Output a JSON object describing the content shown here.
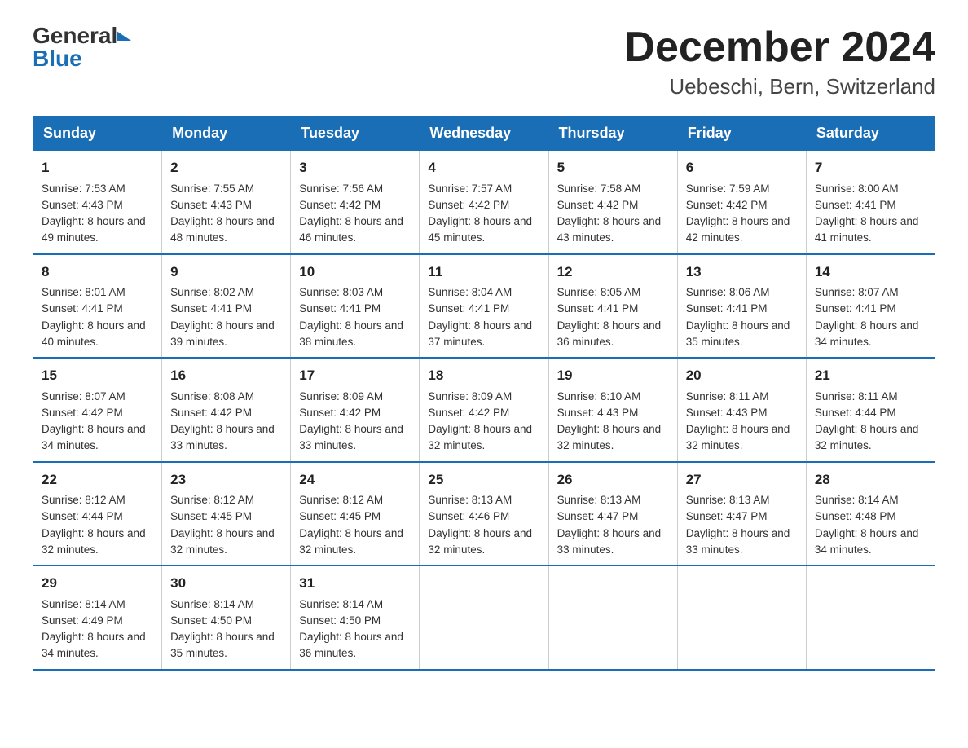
{
  "logo": {
    "general": "General",
    "blue": "Blue"
  },
  "title": "December 2024",
  "subtitle": "Uebeschi, Bern, Switzerland",
  "days_of_week": [
    "Sunday",
    "Monday",
    "Tuesday",
    "Wednesday",
    "Thursday",
    "Friday",
    "Saturday"
  ],
  "weeks": [
    [
      {
        "day": "1",
        "sunrise": "7:53 AM",
        "sunset": "4:43 PM",
        "daylight": "8 hours and 49 minutes."
      },
      {
        "day": "2",
        "sunrise": "7:55 AM",
        "sunset": "4:43 PM",
        "daylight": "8 hours and 48 minutes."
      },
      {
        "day": "3",
        "sunrise": "7:56 AM",
        "sunset": "4:42 PM",
        "daylight": "8 hours and 46 minutes."
      },
      {
        "day": "4",
        "sunrise": "7:57 AM",
        "sunset": "4:42 PM",
        "daylight": "8 hours and 45 minutes."
      },
      {
        "day": "5",
        "sunrise": "7:58 AM",
        "sunset": "4:42 PM",
        "daylight": "8 hours and 43 minutes."
      },
      {
        "day": "6",
        "sunrise": "7:59 AM",
        "sunset": "4:42 PM",
        "daylight": "8 hours and 42 minutes."
      },
      {
        "day": "7",
        "sunrise": "8:00 AM",
        "sunset": "4:41 PM",
        "daylight": "8 hours and 41 minutes."
      }
    ],
    [
      {
        "day": "8",
        "sunrise": "8:01 AM",
        "sunset": "4:41 PM",
        "daylight": "8 hours and 40 minutes."
      },
      {
        "day": "9",
        "sunrise": "8:02 AM",
        "sunset": "4:41 PM",
        "daylight": "8 hours and 39 minutes."
      },
      {
        "day": "10",
        "sunrise": "8:03 AM",
        "sunset": "4:41 PM",
        "daylight": "8 hours and 38 minutes."
      },
      {
        "day": "11",
        "sunrise": "8:04 AM",
        "sunset": "4:41 PM",
        "daylight": "8 hours and 37 minutes."
      },
      {
        "day": "12",
        "sunrise": "8:05 AM",
        "sunset": "4:41 PM",
        "daylight": "8 hours and 36 minutes."
      },
      {
        "day": "13",
        "sunrise": "8:06 AM",
        "sunset": "4:41 PM",
        "daylight": "8 hours and 35 minutes."
      },
      {
        "day": "14",
        "sunrise": "8:07 AM",
        "sunset": "4:41 PM",
        "daylight": "8 hours and 34 minutes."
      }
    ],
    [
      {
        "day": "15",
        "sunrise": "8:07 AM",
        "sunset": "4:42 PM",
        "daylight": "8 hours and 34 minutes."
      },
      {
        "day": "16",
        "sunrise": "8:08 AM",
        "sunset": "4:42 PM",
        "daylight": "8 hours and 33 minutes."
      },
      {
        "day": "17",
        "sunrise": "8:09 AM",
        "sunset": "4:42 PM",
        "daylight": "8 hours and 33 minutes."
      },
      {
        "day": "18",
        "sunrise": "8:09 AM",
        "sunset": "4:42 PM",
        "daylight": "8 hours and 32 minutes."
      },
      {
        "day": "19",
        "sunrise": "8:10 AM",
        "sunset": "4:43 PM",
        "daylight": "8 hours and 32 minutes."
      },
      {
        "day": "20",
        "sunrise": "8:11 AM",
        "sunset": "4:43 PM",
        "daylight": "8 hours and 32 minutes."
      },
      {
        "day": "21",
        "sunrise": "8:11 AM",
        "sunset": "4:44 PM",
        "daylight": "8 hours and 32 minutes."
      }
    ],
    [
      {
        "day": "22",
        "sunrise": "8:12 AM",
        "sunset": "4:44 PM",
        "daylight": "8 hours and 32 minutes."
      },
      {
        "day": "23",
        "sunrise": "8:12 AM",
        "sunset": "4:45 PM",
        "daylight": "8 hours and 32 minutes."
      },
      {
        "day": "24",
        "sunrise": "8:12 AM",
        "sunset": "4:45 PM",
        "daylight": "8 hours and 32 minutes."
      },
      {
        "day": "25",
        "sunrise": "8:13 AM",
        "sunset": "4:46 PM",
        "daylight": "8 hours and 32 minutes."
      },
      {
        "day": "26",
        "sunrise": "8:13 AM",
        "sunset": "4:47 PM",
        "daylight": "8 hours and 33 minutes."
      },
      {
        "day": "27",
        "sunrise": "8:13 AM",
        "sunset": "4:47 PM",
        "daylight": "8 hours and 33 minutes."
      },
      {
        "day": "28",
        "sunrise": "8:14 AM",
        "sunset": "4:48 PM",
        "daylight": "8 hours and 34 minutes."
      }
    ],
    [
      {
        "day": "29",
        "sunrise": "8:14 AM",
        "sunset": "4:49 PM",
        "daylight": "8 hours and 34 minutes."
      },
      {
        "day": "30",
        "sunrise": "8:14 AM",
        "sunset": "4:50 PM",
        "daylight": "8 hours and 35 minutes."
      },
      {
        "day": "31",
        "sunrise": "8:14 AM",
        "sunset": "4:50 PM",
        "daylight": "8 hours and 36 minutes."
      },
      null,
      null,
      null,
      null
    ]
  ]
}
